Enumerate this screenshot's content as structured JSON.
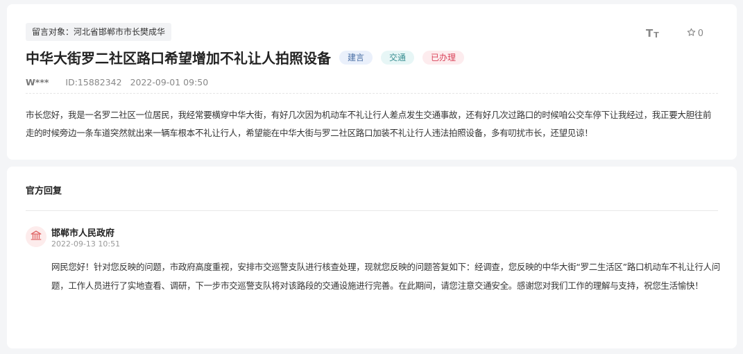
{
  "message": {
    "target": "留言对象：河北省邯郸市市长樊成华",
    "font_tool": {
      "big": "T",
      "small": "T"
    },
    "favorite_count": "0",
    "title": "中华大街罗二社区路口希望增加不礼让人拍照设备",
    "badges": {
      "type": "建言",
      "category": "交通",
      "status": "已办理"
    },
    "author": "W***",
    "id_text": "ID:15882342",
    "datetime": "2022-09-01 09:50",
    "content": "市长您好，我是一名罗二社区一位居民，我经常要横穿中华大街，有好几次因为机动车不礼让行人差点发生交通事故，还有好几次过路口的时候咱公交车停下让我经过，我正要大胆往前走的时候旁边一条车道突然就出来一辆车根本不礼让行人，希望能在中华大街与罗二社区路口加装不礼让行人违法拍照设备，多有叨扰市长，还望见谅！"
  },
  "reply": {
    "heading": "官方回复",
    "org_name": "邯郸市人民政府",
    "datetime": "2022-09-13 10:51",
    "content": "网民您好！针对您反映的问题，市政府高度重视，安排市交巡警支队进行核查处理，现就您反映的问题答复如下：经调查，您反映的中华大街“罗二生活区”路口机动车不礼让行人问题，工作人员进行了实地查看、调研，下一步市交巡警支队将对该路段的交通设施进行完善。在此期间，请您注意交通安全。感谢您对我们工作的理解与支持，祝您生活愉快！"
  },
  "icons": {
    "font_size": "font-size-icon",
    "star": "star-outline-icon",
    "avatar": "government-emblem-icon"
  },
  "colors": {
    "badge_status": "#d9435a",
    "badge_category": "#3a8f92",
    "badge_type": "#4a6fa5",
    "avatar_accent": "#e06767"
  }
}
